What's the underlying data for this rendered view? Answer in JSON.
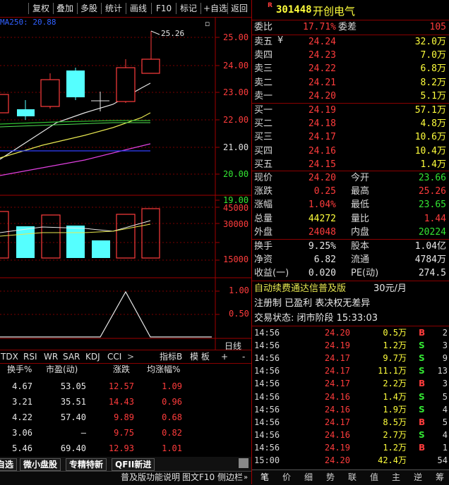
{
  "toolbar": {
    "buttons": [
      "复权",
      "叠加",
      "多股",
      "统计",
      "画线",
      "F10",
      "标记",
      "+自选",
      "返回"
    ]
  },
  "chart": {
    "ma_label": "MA250: 20.88",
    "high_label": "25.26",
    "price_axis": [
      "25.00",
      "24.00",
      "23.00",
      "22.00",
      "21.00",
      "20.00",
      "19.00"
    ],
    "vol_axis": [
      "45000",
      "30000",
      "15000"
    ],
    "ind_axis": [
      "1.00",
      "0.50"
    ],
    "unit_label": "日线",
    "colors": {
      "up": "#ff3c3c",
      "down": "#55ffff",
      "grid": "#8b0000"
    }
  },
  "indicator_tabs": [
    "TDX",
    "RSI",
    "WR",
    "SAR",
    "KDJ",
    "CCI"
  ],
  "indicator_b": "指标B",
  "template_label": "模 板",
  "plus": "+",
  "minus": "-",
  "table": {
    "headers": [
      "换手%",
      "市盈(动)",
      "涨跌",
      "均涨幅%"
    ],
    "rows": [
      [
        "4.67",
        "53.05",
        "12.57",
        "1.09"
      ],
      [
        "3.21",
        "35.51",
        "14.43",
        "0.96"
      ],
      [
        "4.22",
        "57.40",
        "9.89",
        "0.68"
      ],
      [
        "3.06",
        "–",
        "9.75",
        "0.82"
      ],
      [
        "5.46",
        "69.40",
        "12.93",
        "1.01"
      ]
    ]
  },
  "sector_tabs": [
    "自选",
    "微小盘股",
    "专精特新",
    "QFII新进"
  ],
  "bottom_bar": [
    "普及版功能说明",
    "图文F10",
    "侧边栏"
  ],
  "stock": {
    "badge": "R",
    "code": "301448",
    "name": "开创电气",
    "wb_label": "委比",
    "wb_value": "17.71%",
    "wc_label": "委差",
    "wc_value": "105",
    "asks": [
      {
        "label": "卖五",
        "price": "24.24",
        "vol": "32.0万"
      },
      {
        "label": "卖四",
        "price": "24.23",
        "vol": "7.0万"
      },
      {
        "label": "卖三",
        "price": "24.22",
        "vol": "6.8万"
      },
      {
        "label": "卖二",
        "price": "24.21",
        "vol": "8.2万"
      },
      {
        "label": "卖一",
        "price": "24.20",
        "vol": "5.1万"
      }
    ],
    "bids": [
      {
        "label": "买一",
        "price": "24.19",
        "vol": "57.1万"
      },
      {
        "label": "买二",
        "price": "24.18",
        "vol": "4.8万"
      },
      {
        "label": "买三",
        "price": "24.17",
        "vol": "10.6万"
      },
      {
        "label": "买四",
        "price": "24.16",
        "vol": "10.4万"
      },
      {
        "label": "买五",
        "price": "24.15",
        "vol": "1.4万"
      }
    ],
    "yen": "¥",
    "quote": [
      {
        "l1": "现价",
        "v1": "24.20",
        "c1": "red",
        "l2": "今开",
        "v2": "23.66",
        "c2": "green"
      },
      {
        "l1": "涨跌",
        "v1": "0.25",
        "c1": "red",
        "l2": "最高",
        "v2": "25.26",
        "c2": "red"
      },
      {
        "l1": "涨幅",
        "v1": "1.04%",
        "c1": "red",
        "l2": "最低",
        "v2": "23.65",
        "c2": "green"
      },
      {
        "l1": "总量",
        "v1": "44272",
        "c1": "yellow",
        "l2": "量比",
        "v2": "1.44",
        "c2": "red"
      },
      {
        "l1": "外盘",
        "v1": "24048",
        "c1": "red",
        "l2": "内盘",
        "v2": "20224",
        "c2": "green"
      }
    ],
    "quote2": [
      {
        "l1": "换手",
        "v1": "9.25%",
        "l2": "股本",
        "v2": "1.04亿"
      },
      {
        "l1": "净资",
        "v1": "6.82",
        "l2": "流通",
        "v2": "4784万"
      },
      {
        "l1": "收益(一)",
        "v1": "0.020",
        "l2": "PE(动)",
        "v2": "274.5"
      }
    ],
    "promo_text": "自动续费通达信普及版",
    "promo_price": "30元/月",
    "reg_info": "注册制 已盈利 表决权无差异",
    "trade_status": "交易状态: 闭市阶段 15:33:03"
  },
  "ticks": [
    {
      "time": "14:56",
      "price": "24.20",
      "vol": "0.5万",
      "bs": "B",
      "n": "2"
    },
    {
      "time": "14:56",
      "price": "24.19",
      "vol": "1.2万",
      "bs": "S",
      "n": "3"
    },
    {
      "time": "14:56",
      "price": "24.17",
      "vol": "9.7万",
      "bs": "S",
      "n": "9"
    },
    {
      "time": "14:56",
      "price": "24.17",
      "vol": "11.1万",
      "bs": "S",
      "n": "13"
    },
    {
      "time": "14:56",
      "price": "24.17",
      "vol": "2.2万",
      "bs": "B",
      "n": "3"
    },
    {
      "time": "14:56",
      "price": "24.16",
      "vol": "1.4万",
      "bs": "S",
      "n": "5"
    },
    {
      "time": "14:56",
      "price": "24.16",
      "vol": "1.9万",
      "bs": "S",
      "n": "4"
    },
    {
      "time": "14:56",
      "price": "24.17",
      "vol": "8.5万",
      "bs": "B",
      "n": "5"
    },
    {
      "time": "14:56",
      "price": "24.16",
      "vol": "2.7万",
      "bs": "S",
      "n": "4"
    },
    {
      "time": "14:56",
      "price": "24.19",
      "vol": "1.2万",
      "bs": "B",
      "n": "1"
    },
    {
      "time": "15:00",
      "price": "24.20",
      "vol": "42.4万",
      "bs": "",
      "n": "54"
    }
  ],
  "right_tabs": [
    "笔",
    "价",
    "细",
    "势",
    "联",
    "值",
    "主",
    "逆",
    "筹"
  ]
}
